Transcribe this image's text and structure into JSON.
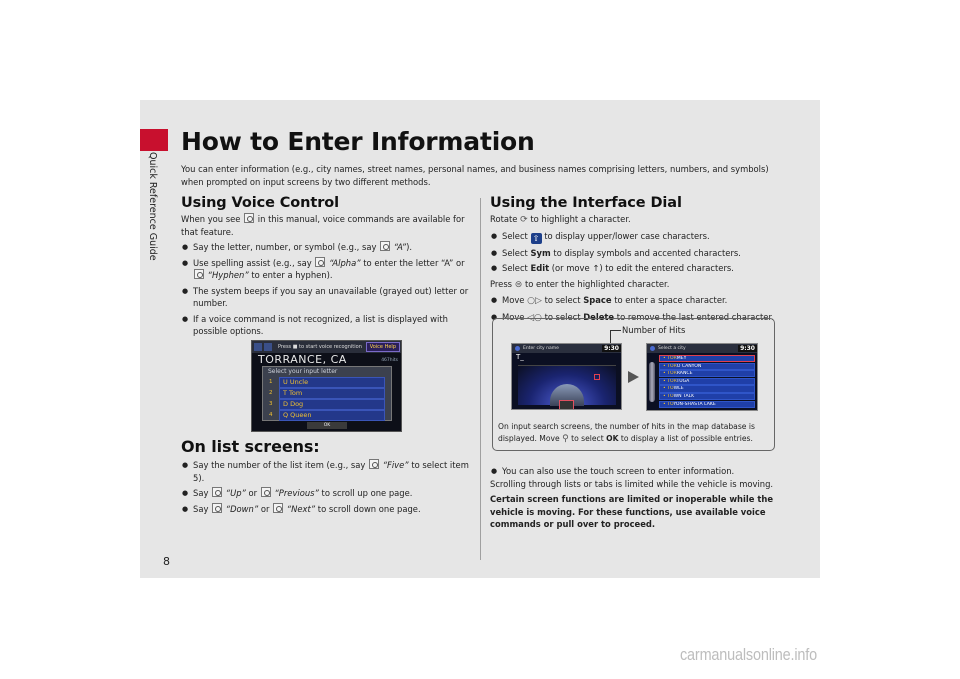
{
  "page": {
    "section_label": "Quick Reference Guide",
    "page_number": "8",
    "accent_color": "#c8102e",
    "title": "How to Enter Information",
    "intro": "You can enter information (e.g., city names, street names, personal names, and business names comprising letters, numbers, and symbols) when prompted on input screens by two different methods."
  },
  "voice": {
    "heading": "Using Voice Control",
    "intro_pre": "When you see",
    "intro_post": "in this manual, voice commands are available for that feature.",
    "bullets": [
      {
        "pre": "Say the letter, number, or symbol (e.g., say",
        "cmd": "“A”",
        "post": ")."
      },
      {
        "pre": "Use spelling assist (e.g., say",
        "cmd": "“Alpha”",
        "mid": "to enter the letter “A” or",
        "cmd2": "“Hyphen”",
        "post": "to enter a hyphen)."
      },
      {
        "text": "The system beeps if you say an unavailable (grayed out) letter or number."
      },
      {
        "text": "If a voice command is not recognized, a list is displayed with possible options."
      }
    ]
  },
  "voice_screen": {
    "prompt": "Press ■ to start voice recognition",
    "voice_help": "Voice Help",
    "city": "TORRANCE, CA",
    "count": "467hits",
    "panel_title": "Select your input letter",
    "options": [
      {
        "num": "1",
        "label": "U Uncle"
      },
      {
        "num": "2",
        "label": "T Tom"
      },
      {
        "num": "3",
        "label": "D Dog"
      },
      {
        "num": "4",
        "label": "Q Queen"
      }
    ],
    "ok": "OK"
  },
  "list_screens": {
    "heading": "On list screens:",
    "bullets": [
      {
        "pre": "Say the number of the list item (e.g., say",
        "cmd": "“Five”",
        "post": "to select item 5)."
      },
      {
        "pre": "Say",
        "cmd": "“Up”",
        "mid": "or",
        "cmd2": "“Previous”",
        "post": "to scroll up one page."
      },
      {
        "pre": "Say",
        "cmd": "“Down”",
        "mid": "or",
        "cmd2": "“Next”",
        "post": "to scroll down one page."
      }
    ]
  },
  "dial": {
    "heading": "Using the Interface Dial",
    "rotate_pre": "Rotate",
    "rotate_post": "to highlight a character.",
    "bullets1": [
      {
        "pre": "Select",
        "icon": "home",
        "post": "to display upper/lower case characters."
      },
      {
        "pre": "Select",
        "bold": "Sym",
        "post": "to display symbols and accented characters."
      },
      {
        "pre": "Select",
        "bold": "Edit",
        "post": "(or move ↑) to edit the entered characters."
      }
    ],
    "press_pre": "Press",
    "press_post": "to enter the highlighted character.",
    "bullets2": [
      {
        "pre": "Move",
        "glyph": "○▷",
        "mid": "to select",
        "bold": "Space",
        "post": "to enter a space character."
      },
      {
        "pre": "Move",
        "glyph": "◁○",
        "mid": "to select",
        "bold": "Delete",
        "post": "to remove the last entered character."
      }
    ]
  },
  "callout": {
    "hits_label": "Number of Hits",
    "text_pre": "On input search screens, the number of hits in the map database is displayed. Move",
    "text_mid": "to select",
    "text_bold": "OK",
    "text_post": "to display a list of possible entries.",
    "entry_screen": {
      "title": "Enter city name",
      "time": "9:30",
      "entry": "T_",
      "count": "162HITS"
    },
    "list_screen": {
      "title": "Select a city",
      "time": "9:30",
      "rows": [
        {
          "hit": "TOR",
          "rest": "MEY",
          "selected": true
        },
        {
          "hit": "TOR",
          "rest": "O CANYON",
          "selected": false
        },
        {
          "hit": "TOR",
          "rest": "RANCE",
          "selected": false
        },
        {
          "hit": "TOR",
          "rest": "TUGA",
          "selected": false
        },
        {
          "hit": "TO",
          "rest": "WLE",
          "selected": false
        },
        {
          "hit": "TO",
          "rest": "WN TALK",
          "selected": false
        },
        {
          "hit": "TO",
          "rest": "YON-SHASTA LAKE",
          "selected": false
        }
      ]
    }
  },
  "footer": {
    "touch_bullet": "You can also use the touch screen to enter information.",
    "scroll_note": "Scrolling through lists or tabs is limited while the vehicle is moving.",
    "warning": "Certain screen functions are limited or inoperable while the vehicle is moving. For these functions, use available voice commands or pull over to proceed."
  },
  "watermark": "carmanualsonline.info"
}
